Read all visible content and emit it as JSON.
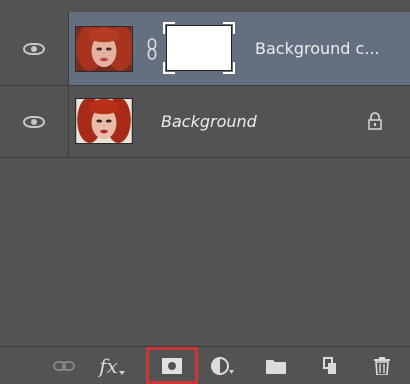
{
  "layers": [
    {
      "name": "Background c...",
      "visible": true,
      "has_mask": true,
      "selected": true,
      "locked": false,
      "italic": false
    },
    {
      "name": "Background",
      "visible": true,
      "has_mask": false,
      "selected": false,
      "locked": true,
      "italic": true
    }
  ],
  "toolbar": {
    "items": [
      {
        "icon": "link-layers-icon"
      },
      {
        "icon": "fx-icon",
        "label": "fx"
      },
      {
        "icon": "add-layer-mask-icon",
        "highlighted": true
      },
      {
        "icon": "adjustment-layer-icon"
      },
      {
        "icon": "new-group-icon"
      },
      {
        "icon": "new-layer-icon"
      },
      {
        "icon": "trash-icon"
      }
    ]
  },
  "colors": {
    "panel_bg": "#535353",
    "selected_row": "#646f80",
    "highlight": "#c8383a"
  }
}
